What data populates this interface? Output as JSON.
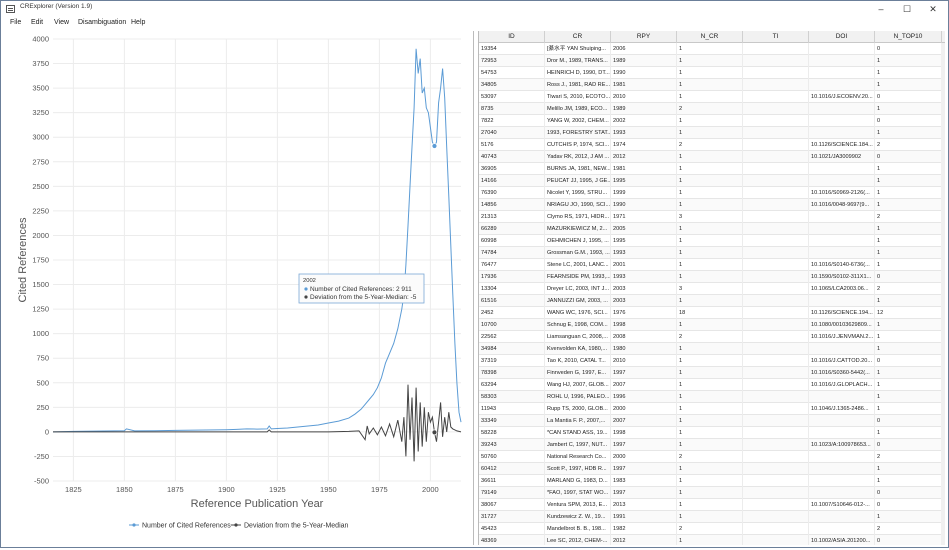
{
  "window": {
    "title": "CRExplorer (Version 1.9)",
    "minimize_glyph": "–",
    "maximize_glyph": "☐",
    "close_glyph": "✕"
  },
  "menu": [
    "File",
    "Edit",
    "View",
    "Disambiguation",
    "Help"
  ],
  "chart_data": {
    "type": "line",
    "xlabel": "Reference Publication Year",
    "ylabel": "Cited References",
    "xlim": [
      1815,
      2015
    ],
    "ylim": [
      -500,
      4000
    ],
    "x_ticks": [
      1825,
      1850,
      1875,
      1900,
      1925,
      1950,
      1975,
      2000
    ],
    "y_ticks": [
      4000,
      3750,
      3500,
      3250,
      3000,
      2750,
      2500,
      2250,
      2000,
      1750,
      1500,
      1250,
      1000,
      750,
      500,
      250,
      0,
      -250,
      -500
    ],
    "grid": true,
    "legend_position": "bottom",
    "series": [
      {
        "name": "Number of Cited References",
        "color": "#5b9bd5",
        "x": [
          1815,
          1825,
          1835,
          1845,
          1850,
          1851,
          1855,
          1865,
          1875,
          1885,
          1895,
          1900,
          1905,
          1910,
          1915,
          1920,
          1921,
          1922,
          1925,
          1930,
          1935,
          1940,
          1945,
          1950,
          1955,
          1960,
          1963,
          1966,
          1968,
          1970,
          1972,
          1974,
          1976,
          1978,
          1980,
          1982,
          1984,
          1986,
          1987,
          1988,
          1989,
          1990,
          1991,
          1992,
          1993,
          1994,
          1995,
          1996,
          1997,
          1998,
          1999,
          2000,
          2001,
          2002,
          2003,
          2004,
          2005,
          2006,
          2007,
          2008,
          2009,
          2010,
          2011,
          2012,
          2013,
          2014,
          2015
        ],
        "y": [
          0,
          5,
          8,
          10,
          12,
          30,
          10,
          12,
          15,
          18,
          20,
          22,
          25,
          30,
          28,
          30,
          60,
          30,
          35,
          40,
          50,
          60,
          70,
          90,
          110,
          140,
          180,
          230,
          280,
          330,
          380,
          450,
          550,
          700,
          800,
          900,
          1050,
          1250,
          1400,
          1700,
          2100,
          2500,
          2900,
          3300,
          3900,
          3650,
          3800,
          3450,
          3500,
          3300,
          3250,
          3100,
          2950,
          2911,
          2950,
          3350,
          3500,
          3700,
          3400,
          2900,
          2400,
          1900,
          1400,
          900,
          500,
          200,
          100
        ]
      },
      {
        "name": "Deviation from the 5-Year-Median",
        "color": "#444444",
        "x": [
          1815,
          1850,
          1900,
          1920,
          1921,
          1922,
          1950,
          1960,
          1965,
          1968,
          1969,
          1970,
          1972,
          1974,
          1976,
          1978,
          1980,
          1982,
          1984,
          1986,
          1987,
          1988,
          1989,
          1990,
          1991,
          1992,
          1993,
          1994,
          1995,
          1996,
          1997,
          1998,
          1999,
          2000,
          2001,
          2002,
          2003,
          2004,
          2005,
          2006,
          2007,
          2008,
          2009,
          2010,
          2011,
          2012,
          2013,
          2014,
          2015
        ],
        "y": [
          0,
          0,
          0,
          0,
          20,
          0,
          0,
          5,
          10,
          -80,
          60,
          -20,
          40,
          -30,
          50,
          -40,
          80,
          -50,
          120,
          -100,
          150,
          -250,
          480,
          -80,
          350,
          -300,
          450,
          -200,
          300,
          -150,
          250,
          -100,
          200,
          100,
          150,
          -5,
          -100,
          100,
          300,
          -50,
          150,
          0,
          200,
          50,
          30,
          20,
          10,
          5,
          0
        ]
      }
    ],
    "tooltip": {
      "year": "2002",
      "line1": "Number of Cited References: 2 911",
      "line2": "Deviation from the 5-Year-Median: -5"
    }
  },
  "table": {
    "columns": [
      "ID",
      "CR",
      "RPY",
      "N_CR",
      "TI",
      "DOI",
      "N_TOP10"
    ],
    "rows": [
      [
        "19354",
        "[綦水平 YAN Shuiping...",
        "2006",
        "1",
        "",
        "",
        "0"
      ],
      [
        "72953",
        "Dror M., 1989, TRANS...",
        "1989",
        "1",
        "",
        "",
        "1"
      ],
      [
        "54753",
        "HEINRICH D, 1990, DT...",
        "1990",
        "1",
        "",
        "",
        "1"
      ],
      [
        "34805",
        "Ross J., 1981, RAD RE...",
        "1981",
        "1",
        "",
        "",
        "1"
      ],
      [
        "53097",
        "Tiwari S, 2010, ECOTO...",
        "2010",
        "1",
        "",
        "10.1016/J.ECOENV.20...",
        "0"
      ],
      [
        "8735",
        "Melillo JM, 1989, ECO...",
        "1989",
        "2",
        "",
        "",
        "1"
      ],
      [
        "7822",
        "YANG W, 2002, CHEM...",
        "2002",
        "1",
        "",
        "",
        "0"
      ],
      [
        "27040",
        "1993, FORESTRY STAT...",
        "1993",
        "1",
        "",
        "",
        "1"
      ],
      [
        "5176",
        "CUTCHIS P, 1974, SCI...",
        "1974",
        "2",
        "",
        "10.1126/SCIENCE.184...",
        "2"
      ],
      [
        "40743",
        "Yadav RK, 2012, J AM ...",
        "2012",
        "1",
        "",
        "10.1021/JA3009902",
        "0"
      ],
      [
        "36905",
        "BURNS JA, 1981, NEW...",
        "1981",
        "1",
        "",
        "",
        "1"
      ],
      [
        "14166",
        "PEUCAT JJ, 1995, J GE...",
        "1995",
        "1",
        "",
        "",
        "1"
      ],
      [
        "76390",
        "Nicolet Y, 1999, STRU...",
        "1999",
        "1",
        "",
        "10.1016/S0969-2126(...",
        "1"
      ],
      [
        "14856",
        "NRIAGU JO, 1990, SCI...",
        "1990",
        "1",
        "",
        "10.1016/0048-9697(9...",
        "1"
      ],
      [
        "21313",
        "Clymo RS, 1971, HIDR...",
        "1971",
        "3",
        "",
        "",
        "2"
      ],
      [
        "66289",
        "MAZURKIEWICZ M, 2...",
        "2005",
        "1",
        "",
        "",
        "1"
      ],
      [
        "60998",
        "OEHMICHEN J, 1995, ...",
        "1995",
        "1",
        "",
        "",
        "1"
      ],
      [
        "74784",
        "Grossman G.M., 1993, ...",
        "1993",
        "1",
        "",
        "",
        "1"
      ],
      [
        "76477",
        "Stene LC, 2001, LANC...",
        "2001",
        "1",
        "",
        "10.1016/S0140-6736(...",
        "1"
      ],
      [
        "17936",
        "FEARNSIDE PM, 1993,...",
        "1993",
        "1",
        "",
        "10.1590/S0102-311X1...",
        "0"
      ],
      [
        "13304",
        "Dreyer LC, 2003, INT J...",
        "2003",
        "3",
        "",
        "10.1065/LCA2003.06...",
        "2"
      ],
      [
        "61516",
        "JANNUZZI GM, 2003, ...",
        "2003",
        "1",
        "",
        "",
        "1"
      ],
      [
        "2452",
        "WANG WC, 1976, SCI...",
        "1976",
        "18",
        "",
        "10.1126/SCIENCE.194...",
        "12"
      ],
      [
        "10700",
        "Schnug E, 1998, COM...",
        "1998",
        "1",
        "",
        "10.1080/00103629809...",
        "1"
      ],
      [
        "22562",
        "Liamsanguan C, 2008,...",
        "2008",
        "2",
        "",
        "10.1016/J.JENVMAN.2...",
        "1"
      ],
      [
        "34984",
        "Kvenvolden KA, 1980,...",
        "1980",
        "1",
        "",
        "",
        "1"
      ],
      [
        "37319",
        "Tao K, 2010, CATAL T...",
        "2010",
        "1",
        "",
        "10.1016/J.CATTOD.20...",
        "0"
      ],
      [
        "78398",
        "Finnveden G, 1997, E...",
        "1997",
        "1",
        "",
        "10.1016/S0360-5442(...",
        "1"
      ],
      [
        "63294",
        "Wang HJ, 2007, GLOB...",
        "2007",
        "1",
        "",
        "10.1016/J.GLOPLACH...",
        "1"
      ],
      [
        "58303",
        "ROHL U, 1996, PALEO...",
        "1996",
        "1",
        "",
        "",
        "1"
      ],
      [
        "11943",
        "Rupp TS, 2000, GLOB...",
        "2000",
        "1",
        "",
        "10.1046/J.1365-2486...",
        "1"
      ],
      [
        "33349",
        "La Mantia F. P., 2007,...",
        "2007",
        "1",
        "",
        "",
        "0"
      ],
      [
        "58228",
        "*CAN STAND ASS, 19...",
        "1998",
        "1",
        "",
        "",
        "1"
      ],
      [
        "39243",
        "Jambert C, 1997, NUT...",
        "1997",
        "1",
        "",
        "10.1023/A:100978653...",
        "0"
      ],
      [
        "50760",
        "National Research Co...",
        "2000",
        "2",
        "",
        "",
        "2"
      ],
      [
        "60412",
        "Scott P., 1997, HDB R...",
        "1997",
        "1",
        "",
        "",
        "1"
      ],
      [
        "36611",
        "MARLAND G, 1983, D...",
        "1983",
        "1",
        "",
        "",
        "1"
      ],
      [
        "79149",
        "*FAO, 1997, STAT WO...",
        "1997",
        "1",
        "",
        "",
        "0"
      ],
      [
        "38067",
        "Ventura SPM, 2013, E...",
        "2013",
        "1",
        "",
        "10.1007/S10646-012-...",
        "0"
      ],
      [
        "31727",
        "Kundzewicz Z. W., 19...",
        "1991",
        "1",
        "",
        "",
        "1"
      ],
      [
        "45423",
        "Mandelbrot B. B., 198...",
        "1982",
        "2",
        "",
        "",
        "2"
      ],
      [
        "48369",
        "Lee SC, 2012, CHEM-...",
        "2012",
        "1",
        "",
        "10.1002/ASIA.201200...",
        "0"
      ]
    ]
  }
}
